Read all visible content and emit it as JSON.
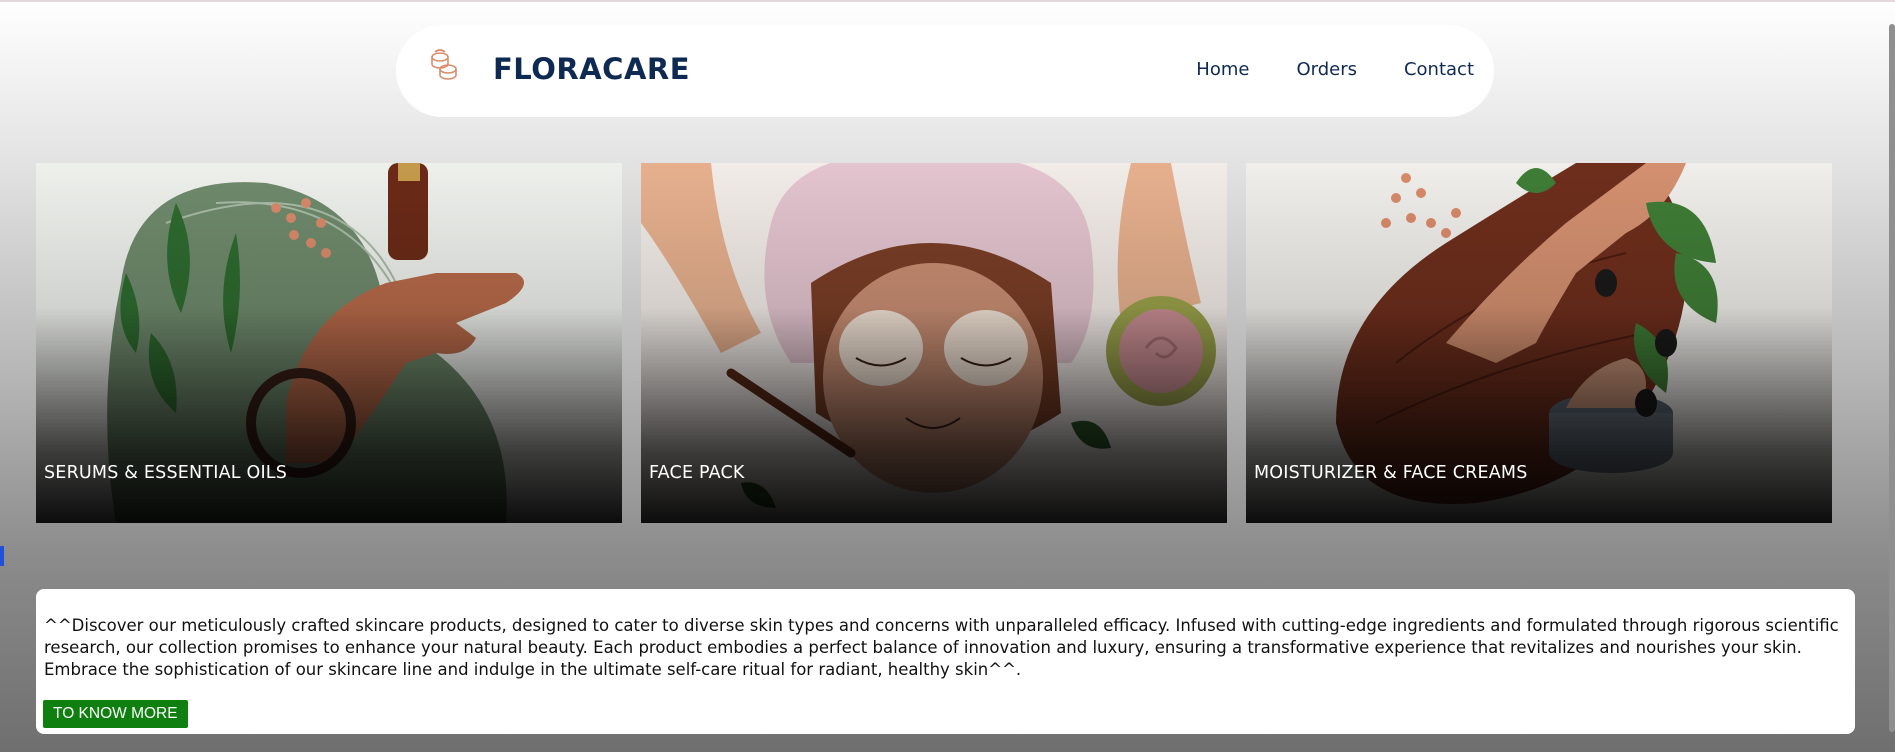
{
  "header": {
    "brand": "FLORACARE",
    "logo_icon": "cream-jars-icon",
    "nav": [
      "Home",
      "Orders",
      "Contact"
    ]
  },
  "categories": [
    {
      "label": "SERUMS & ESSENTIAL OILS",
      "image": "serum-dropper-hand-illustration"
    },
    {
      "label": "FACE PACK",
      "image": "face-mask-woman-illustration"
    },
    {
      "label": "MOISTURIZER & FACE CREAMS",
      "image": "cream-jar-hand-illustration"
    }
  ],
  "info": {
    "text": "^^Discover our meticulously crafted skincare products, designed to cater to diverse skin types and concerns with unparalleled efficacy. Infused with cutting-edge ingredients and formulated through rigorous scientific research, our collection promises to enhance your natural beauty. Each product embodies a perfect balance of innovation and luxury, ensuring a transformative experience that revitalizes and nourishes your skin. Embrace the sophistication of our skincare line and indulge in the ultimate self-care ritual for radiant, healthy skin^^.",
    "button": "TO KNOW MORE"
  },
  "colors": {
    "brand": "#0f2a52",
    "button": "#0f7f0f",
    "accent": "#d98a6a"
  }
}
